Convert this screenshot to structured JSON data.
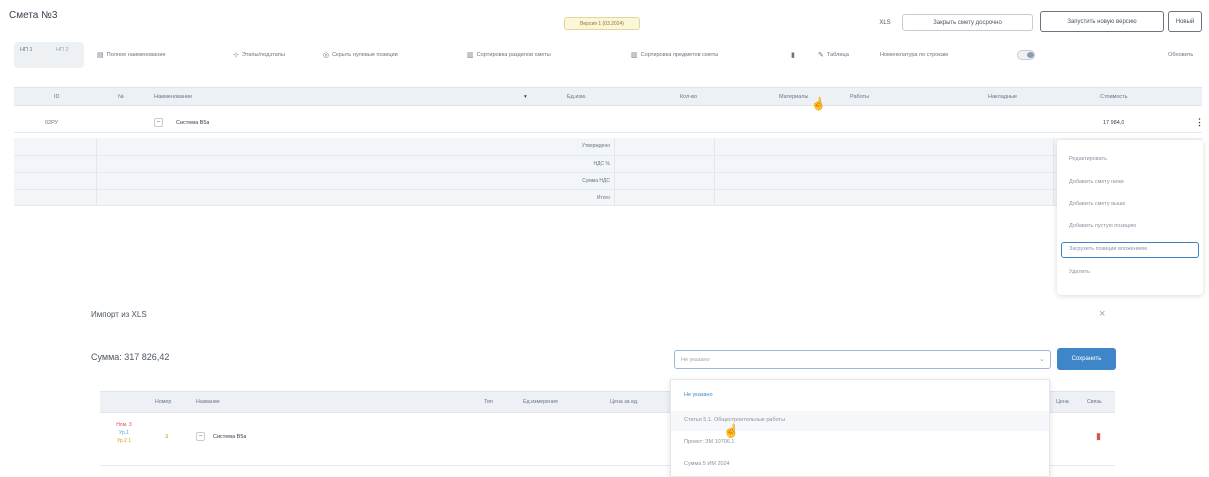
{
  "header": {
    "title": "Смета №3",
    "version_badge": "Версия 1 (03.2024)",
    "xls_button": "XLS",
    "close_estimate_button": "Закрыть смету досрочно",
    "launch_new_version_button": "Запустить новую версию",
    "new_button": "Новый"
  },
  "tabs": [
    "НП 1",
    "НП 2"
  ],
  "toolbar": {
    "full_names": "Полное наименование",
    "stages": "Этапы/подэтапы",
    "hide_empty": "Скрыть нулевые позиции",
    "sort_sections": "Сортировка разделов сметы",
    "sort_items": "Сортировка предметов сметы",
    "table_label": "Таблица",
    "line_numbering": "Номенклатура по строкам",
    "refresh": "Обновить"
  },
  "table": {
    "headers": [
      "ID",
      "№",
      "Наименование",
      "Ед.изм.",
      "Кол-во",
      "Материалы",
      "Работы",
      "Накладные",
      "Стоимость"
    ],
    "rows": [
      {
        "id": "02РУ",
        "name": "Система В5а",
        "cost": "17 984,0"
      }
    ],
    "summary_labels": [
      "Утверждено",
      "НДС %",
      "Сумма НДС",
      "Итого"
    ]
  },
  "context_menu": {
    "items": [
      "Редактировать",
      "Добавить смету ниже",
      "Добавить смету выше",
      "Добавить пустую позицию",
      "Загрузить позиции вложением",
      "Удалить"
    ],
    "highlighted_index": 4
  },
  "import_panel": {
    "title": "Импорт из XLS",
    "sum": "Сумма: 317 826,42",
    "select_placeholder": "Не указано",
    "save_button": "Сохранить",
    "headers": [
      "Номер",
      "Название",
      "Тип",
      "Ед.измерения",
      "Цена за ед.",
      "Цена",
      "Связь"
    ],
    "dropdown_items": [
      "Не указано",
      "Статья 5.1. Общестроительные работы",
      "Проект: ЗМ 10706.1",
      "Сумма 5 ИМ 2024"
    ],
    "rows": [
      {
        "flags": [
          "Ном. 3",
          "Ур.1",
          "Ур.2 1"
        ],
        "number": "3",
        "name": "Система В5а"
      }
    ]
  }
}
